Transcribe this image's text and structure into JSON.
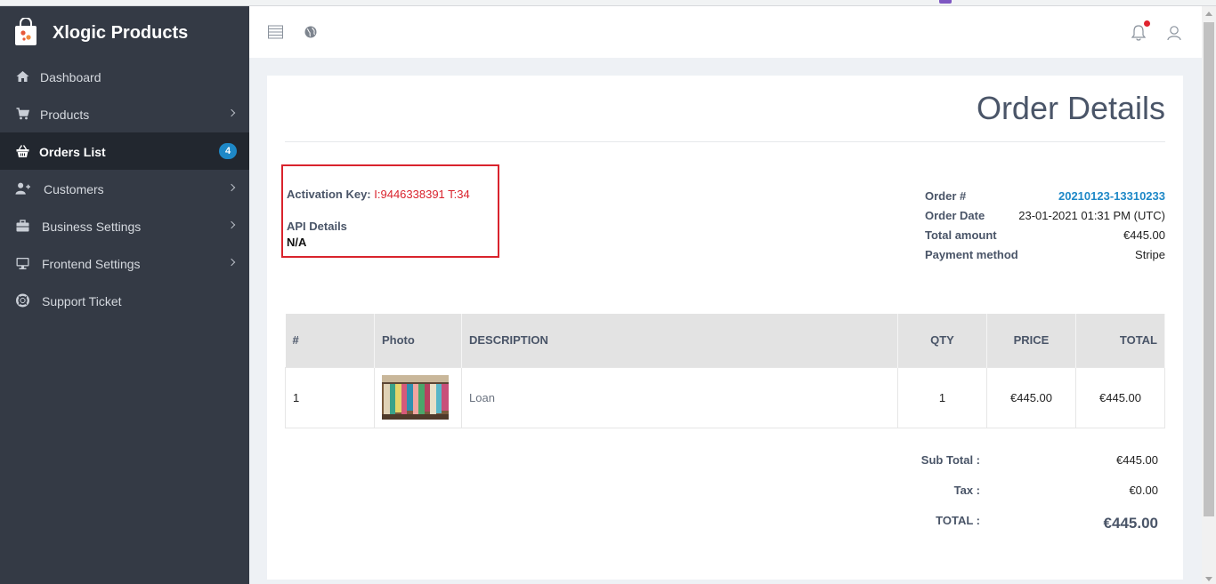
{
  "app": {
    "brand": "Xlogic Products"
  },
  "sidebar": {
    "items": [
      {
        "label": "Dashboard",
        "icon": "home-icon",
        "has_submenu": false
      },
      {
        "label": "Products",
        "icon": "cart-icon",
        "has_submenu": true
      },
      {
        "label": "Orders List",
        "icon": "basket-icon",
        "has_submenu": false,
        "active": true,
        "badge": "4"
      },
      {
        "label": "Customers",
        "icon": "user-add-icon",
        "has_submenu": true
      },
      {
        "label": "Business Settings",
        "icon": "briefcase-icon",
        "has_submenu": true
      },
      {
        "label": "Frontend Settings",
        "icon": "monitor-icon",
        "has_submenu": true
      },
      {
        "label": "Support Ticket",
        "icon": "lifebuoy-icon",
        "has_submenu": false
      }
    ]
  },
  "header": {
    "icons": [
      "menu-toggle-icon",
      "globe-icon",
      "bell-icon",
      "user-icon"
    ],
    "has_notification": true
  },
  "page": {
    "title": "Order Details",
    "activation": {
      "label": "Activation Key:",
      "value": "I:9446338391 T:34"
    },
    "api": {
      "label": "API Details",
      "value": "N/A"
    },
    "order_info": {
      "order_no": {
        "label": "Order #",
        "value": "20210123-13310233"
      },
      "order_date": {
        "label": "Order Date",
        "value": "23-01-2021 01:31 PM (UTC)"
      },
      "total_amount": {
        "label": "Total amount",
        "value": "€445.00"
      },
      "payment_method": {
        "label": "Payment method",
        "value": "Stripe"
      }
    },
    "table": {
      "headers": {
        "num": "#",
        "photo": "Photo",
        "description": "DESCRIPTION",
        "qty": "QTY",
        "price": "PRICE",
        "total": "TOTAL"
      },
      "rows": [
        {
          "num": "1",
          "description": "Loan",
          "qty": "1",
          "price": "€445.00",
          "total": "€445.00"
        }
      ]
    },
    "totals": {
      "subtotal": {
        "label": "Sub Total :",
        "value": "€445.00"
      },
      "tax": {
        "label": "Tax :",
        "value": "€0.00"
      },
      "total": {
        "label": "TOTAL :",
        "value": "€445.00"
      }
    }
  },
  "colors": {
    "sidebar_bg": "#343a45",
    "sidebar_active_bg": "#22272f",
    "accent": "#1e88c7",
    "highlight_border": "#d9232d",
    "title_text": "#4a5568"
  }
}
